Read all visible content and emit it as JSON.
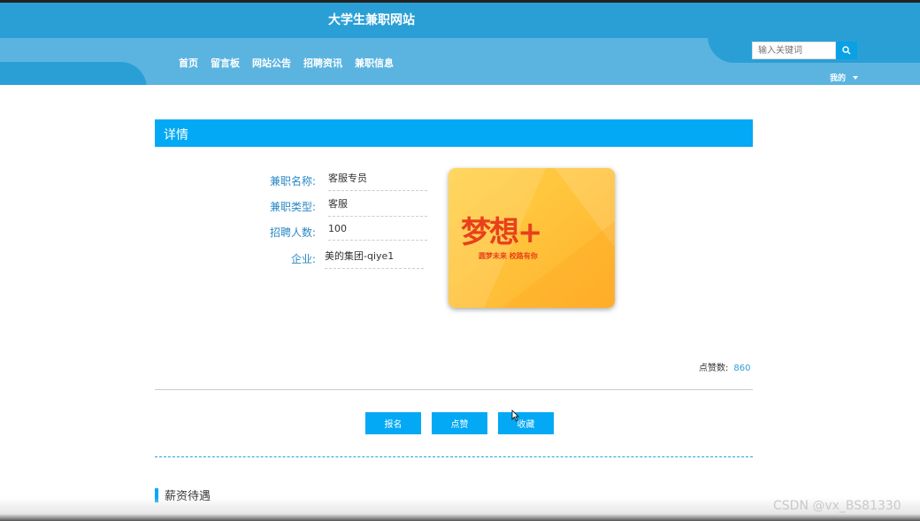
{
  "site": {
    "title": "大学生兼职网站"
  },
  "nav": {
    "items": [
      "首页",
      "留言板",
      "网站公告",
      "招聘资讯",
      "兼职信息"
    ]
  },
  "search": {
    "placeholder": "输入关键词"
  },
  "user_menu": {
    "label": "我的"
  },
  "detail": {
    "heading": "详情",
    "fields": [
      {
        "label": "兼职名称:",
        "value": "客服专员"
      },
      {
        "label": "兼职类型:",
        "value": "客服"
      },
      {
        "label": "招聘人数:",
        "value": "100"
      },
      {
        "label": "企业:",
        "value": "美的集团-qiye1"
      }
    ],
    "poster": {
      "main": "梦想+",
      "sub": "圆梦未来  校路有你"
    },
    "likes_label": "点赞数:",
    "likes_value": "860"
  },
  "actions": {
    "apply": "报名",
    "like": "点赞",
    "favorite": "收藏"
  },
  "section": {
    "salary_title": "薪资待遇"
  },
  "watermark": "CSDN @vx_BS81330",
  "colors": {
    "header": "#2a9fd6",
    "accent": "#03a9f4"
  }
}
